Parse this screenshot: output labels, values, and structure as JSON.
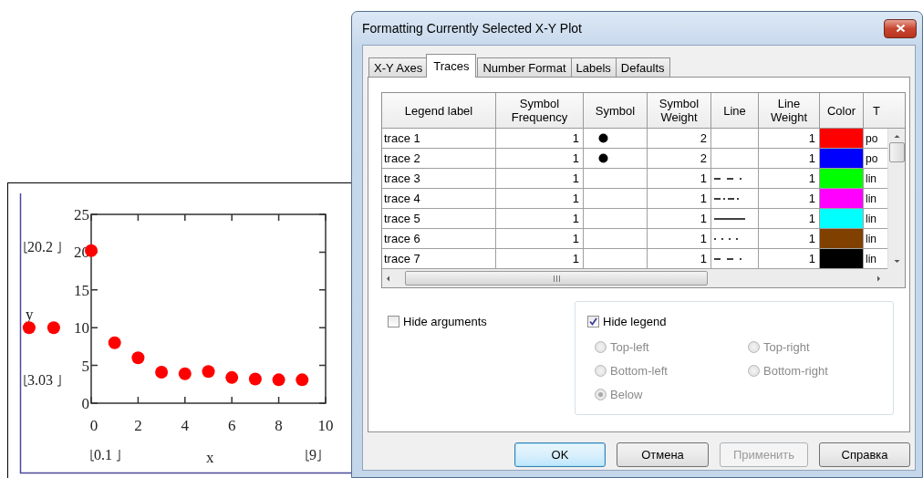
{
  "plot": {
    "x_label": "x",
    "y_range_upper": "20.2",
    "y_range_lower": "3.03",
    "x_range_lower": "0.1",
    "x_range_upper": "9",
    "chart_data": {
      "type": "scatter",
      "x": [
        -2.65,
        -1.6,
        0,
        1,
        2,
        3,
        4,
        5,
        6,
        7,
        8,
        9
      ],
      "series": [
        {
          "name": "y",
          "color": "#ff0000",
          "values": [
            10,
            10,
            20.2,
            8,
            6,
            4.1,
            3.9,
            4.2,
            3.4,
            3.2,
            3.1,
            3.1
          ]
        }
      ],
      "xlim": [
        -3,
        10
      ],
      "ylim": [
        0,
        25
      ],
      "xticks": [
        0,
        2,
        4,
        6,
        8,
        10
      ],
      "yticks": [
        0,
        5,
        10,
        15,
        20,
        25
      ]
    }
  },
  "dialog": {
    "title": "Formatting Currently Selected X-Y Plot",
    "tabs": [
      {
        "label": "X-Y Axes",
        "selected": false
      },
      {
        "label": "Traces",
        "selected": true
      },
      {
        "label": "Number Format",
        "selected": false
      },
      {
        "label": "Labels",
        "selected": false
      },
      {
        "label": "Defaults",
        "selected": false
      }
    ],
    "traces_table": {
      "columns": [
        "Legend label",
        "Symbol Frequency",
        "Symbol",
        "Symbol Weight",
        "Line",
        "Line Weight",
        "Color",
        "T"
      ],
      "rows": [
        {
          "legend_label": "trace 1",
          "symbol_frequency": "1",
          "symbol": {
            "kind": "dot"
          },
          "symbol_weight": "2",
          "line": {
            "kind": "none"
          },
          "line_weight": "1",
          "color": "#ff0000",
          "type": "po"
        },
        {
          "legend_label": "trace 2",
          "symbol_frequency": "1",
          "symbol": {
            "kind": "dot"
          },
          "symbol_weight": "2",
          "line": {
            "kind": "none"
          },
          "line_weight": "1",
          "color": "#0000ff",
          "type": "po"
        },
        {
          "legend_label": "trace 3",
          "symbol_frequency": "1",
          "symbol": {
            "kind": "none"
          },
          "symbol_weight": "1",
          "line": {
            "kind": "dash"
          },
          "line_weight": "1",
          "color": "#00ff00",
          "type": "lin"
        },
        {
          "legend_label": "trace 4",
          "symbol_frequency": "1",
          "symbol": {
            "kind": "none"
          },
          "symbol_weight": "1",
          "line": {
            "kind": "dashdot"
          },
          "line_weight": "1",
          "color": "#ff00ff",
          "type": "lin"
        },
        {
          "legend_label": "trace 5",
          "symbol_frequency": "1",
          "symbol": {
            "kind": "none"
          },
          "symbol_weight": "1",
          "line": {
            "kind": "solid"
          },
          "line_weight": "1",
          "color": "#00ffff",
          "type": "lin"
        },
        {
          "legend_label": "trace 6",
          "symbol_frequency": "1",
          "symbol": {
            "kind": "none"
          },
          "symbol_weight": "1",
          "line": {
            "kind": "dot"
          },
          "line_weight": "1",
          "color": "#804000",
          "type": "lin"
        },
        {
          "legend_label": "trace 7",
          "symbol_frequency": "1",
          "symbol": {
            "kind": "none"
          },
          "symbol_weight": "1",
          "line": {
            "kind": "dash"
          },
          "line_weight": "1",
          "color": "#000000",
          "type": "lin"
        }
      ]
    },
    "hide_arguments": {
      "label": "Hide arguments",
      "checked": false
    },
    "hide_legend": {
      "label": "Hide legend",
      "checked": true
    },
    "legend_position": {
      "disabled": true,
      "options": [
        {
          "label": "Top-left",
          "selected": false
        },
        {
          "label": "Top-right",
          "selected": false
        },
        {
          "label": "Bottom-left",
          "selected": false
        },
        {
          "label": "Bottom-right",
          "selected": false
        },
        {
          "label": "Below",
          "selected": true
        }
      ]
    },
    "buttons": [
      {
        "label": "OK",
        "focused": true,
        "disabled": false
      },
      {
        "label": "Отмена",
        "focused": false,
        "disabled": false
      },
      {
        "label": "Применить",
        "focused": false,
        "disabled": true
      },
      {
        "label": "Справка",
        "focused": false,
        "disabled": false
      }
    ]
  }
}
